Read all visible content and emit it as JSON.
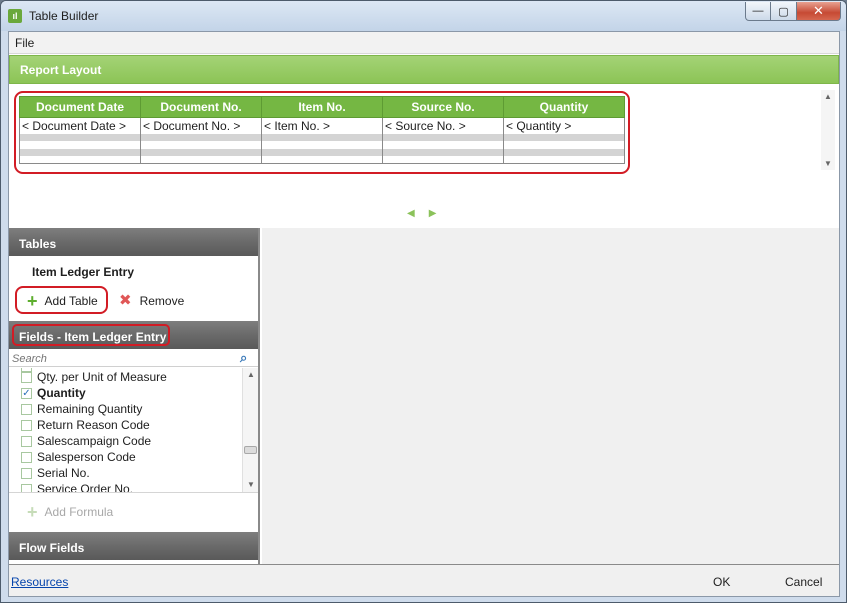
{
  "window": {
    "title": "Table Builder",
    "icon": "table-builder-icon",
    "controls": {
      "minimize": "—",
      "maximize": "▢",
      "close": "✕"
    }
  },
  "menu": {
    "file": "File"
  },
  "report_layout": {
    "header": "Report Layout",
    "columns": [
      "Document Date",
      "Document No.",
      "Item No.",
      "Source No.",
      "Quantity"
    ],
    "row_values": [
      "< Document Date >",
      "< Document No. >",
      "< Item No. >",
      "< Source No. >",
      "< Quantity >"
    ],
    "nav_prev": "◀",
    "nav_next": "▶"
  },
  "tables": {
    "header": "Tables",
    "items": [
      "Item Ledger Entry"
    ],
    "add_label": "Add Table",
    "remove_label": "Remove"
  },
  "fields": {
    "header": "Fields - Item Ledger Entry",
    "search_placeholder": "Search",
    "items": [
      {
        "label": "Qty. per Unit of Measure",
        "checked": false
      },
      {
        "label": "Quantity",
        "checked": true
      },
      {
        "label": "Remaining Quantity",
        "checked": false
      },
      {
        "label": "Return Reason Code",
        "checked": false
      },
      {
        "label": "Salescampaign Code",
        "checked": false
      },
      {
        "label": "Salesperson Code",
        "checked": false
      },
      {
        "label": "Serial No.",
        "checked": false
      },
      {
        "label": "Service Order No.",
        "checked": false
      }
    ],
    "add_formula_label": "Add Formula"
  },
  "flow_fields": {
    "header": "Flow Fields"
  },
  "footer": {
    "resources": "Resources",
    "ok": "OK",
    "cancel": "Cancel"
  },
  "colors": {
    "accent_green": "#75b743",
    "highlight_red": "#d21c25",
    "section_gray": "#6a6a6a"
  }
}
